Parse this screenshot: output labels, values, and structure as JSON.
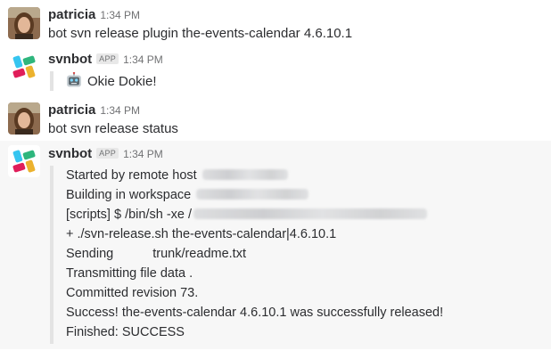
{
  "messages": [
    {
      "author": "patricia",
      "time": "1:34 PM",
      "text": "bot svn release plugin the-events-calendar 4.6.10.1"
    },
    {
      "author": "svnbot",
      "badge": "APP",
      "time": "1:34 PM",
      "attachment_text": "Okie Dokie!",
      "attachment_icon": "robot-face-emoji"
    },
    {
      "author": "patricia",
      "time": "1:34 PM",
      "text": "bot svn release status"
    },
    {
      "author": "svnbot",
      "badge": "APP",
      "time": "1:34 PM",
      "log": {
        "started": "Started by remote host",
        "building": "Building in workspace",
        "scripts": "[scripts] $ /bin/sh -xe /",
        "svn_release": "+ ./svn-release.sh the-events-calendar|4.6.10.1",
        "sending_label": "Sending",
        "sending_file": "trunk/readme.txt",
        "transmitting": "Transmitting file data .",
        "committed": "Committed revision 73.",
        "success": "Success! the-events-calendar 4.6.10.1 was successfully released!",
        "finished": "Finished: SUCCESS"
      }
    }
  ],
  "colors": {
    "attachment_bar": "#e3e3e3",
    "hover_bg": "#f7f7f7",
    "timestamp": "#717274"
  }
}
